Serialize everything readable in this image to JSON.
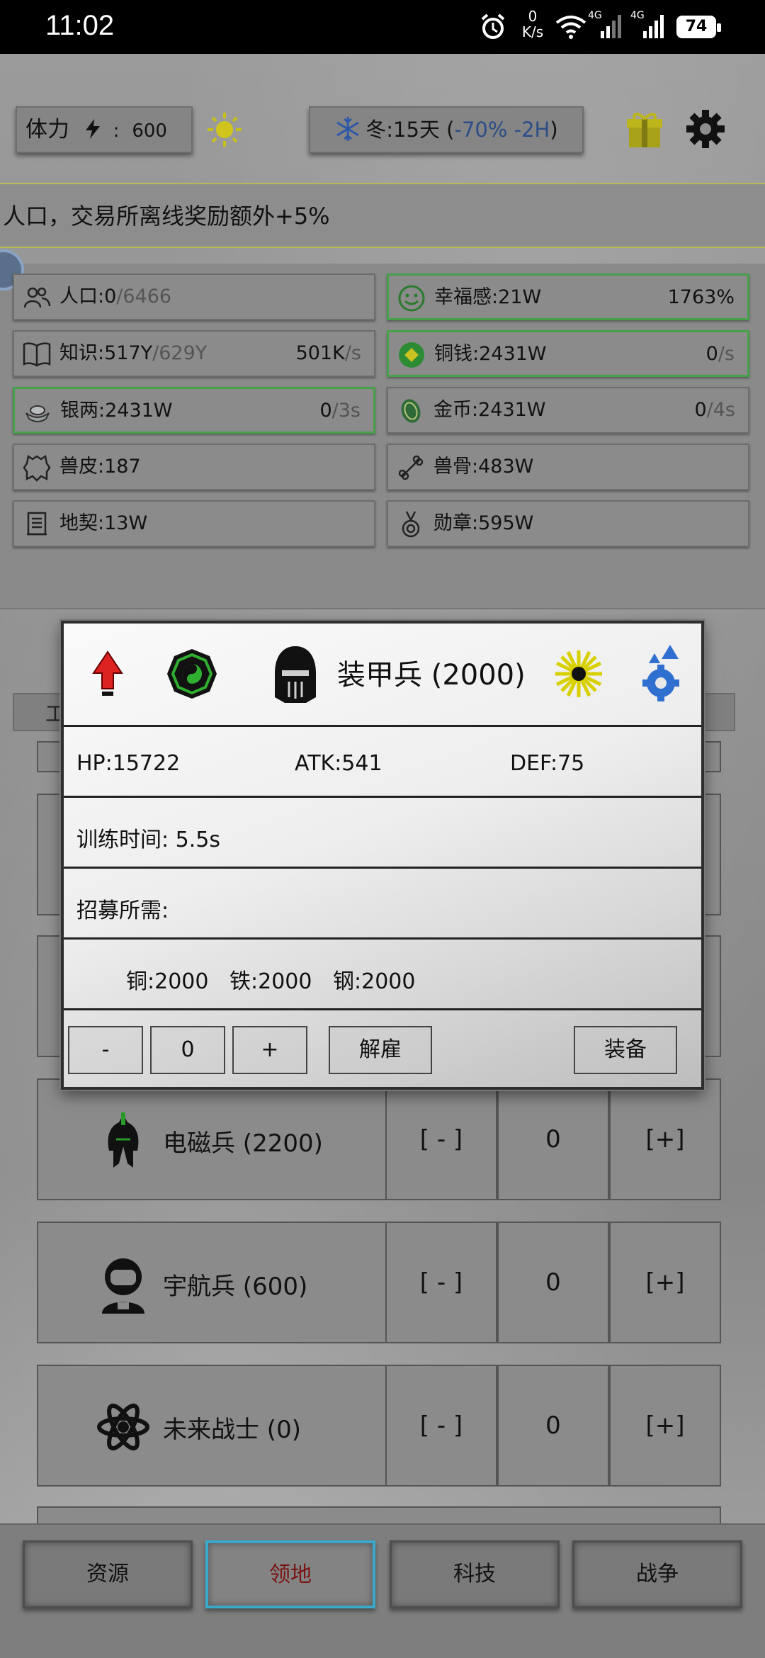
{
  "status_bar": {
    "time": "11:02",
    "net_speed_value": "0",
    "net_speed_unit": "K/s",
    "net_type_1": "4G",
    "net_type_2": "4G",
    "battery": "74",
    "icons": [
      "alarm-icon",
      "wifi-icon",
      "signal-icon",
      "signal-icon",
      "battery-icon"
    ]
  },
  "top_bar": {
    "stamina_label": "体力",
    "stamina_sep": ":",
    "stamina_value": "600",
    "season_text": "冬:15天 (",
    "season_delta": "-70% -2H",
    "season_close": ")",
    "icons": [
      "lightning-icon",
      "sun-icon",
      "snowflake-icon",
      "gift-icon",
      "gear-icon"
    ]
  },
  "ticker": {
    "text": "人口，交易所离线奖励额外+5%"
  },
  "resources": {
    "population": {
      "label": "人口:0",
      "max": "/6466"
    },
    "happiness": {
      "label": "幸福感:21W",
      "rate": "1763%"
    },
    "knowledge": {
      "label": "知识:517Y",
      "max": "/629Y",
      "rate": "501K",
      "rate_unit": "/s"
    },
    "copper_coin": {
      "label": "铜钱:2431W",
      "rate": "0",
      "rate_unit": "/s"
    },
    "silver": {
      "label": "银两:2431W",
      "rate": "0",
      "rate_unit": "/3s"
    },
    "gold": {
      "label": "金币:2431W",
      "rate": "0",
      "rate_unit": "/4s"
    },
    "hide": {
      "label": "兽皮:187"
    },
    "bone": {
      "label": "兽骨:483W"
    },
    "deed": {
      "label": "地契:13W"
    },
    "medal": {
      "label": "勋章:595W"
    }
  },
  "list_header": {
    "label": "工"
  },
  "units": [
    {
      "name": "电磁兵 (2200)",
      "minus": "[ - ]",
      "count": "0",
      "plus": "[+]",
      "icon": "spartan-helmet-icon"
    },
    {
      "name": "宇航兵 (600)",
      "minus": "[ - ]",
      "count": "0",
      "plus": "[+]",
      "icon": "astronaut-icon"
    },
    {
      "name": "未来战士 (0)",
      "minus": "[ - ]",
      "count": "0",
      "plus": "[+]",
      "icon": "atom-icon"
    }
  ],
  "dialog": {
    "title": "装甲兵 (2000)",
    "hp": "HP:15722",
    "atk": "ATK:541",
    "def": "DEF:75",
    "train_time": "训练时间:  5.5s",
    "recruit_label": "招募所需:",
    "cost_copper": "铜:2000",
    "cost_iron": "铁:2000",
    "cost_steel": "钢:2000",
    "minus": "-",
    "quantity": "0",
    "plus": "+",
    "dismiss": "解雇",
    "equip": "装备",
    "icons": [
      "red-up-arrow-icon",
      "green-bagua-icon",
      "knight-helmet-icon",
      "yellow-burst-icon",
      "blue-gear-upgrade-icon"
    ]
  },
  "bottom_nav": [
    {
      "label": "资源",
      "active": false
    },
    {
      "label": "领地",
      "active": true
    },
    {
      "label": "科技",
      "active": false
    },
    {
      "label": "战争",
      "active": false
    }
  ],
  "colors": {
    "active_tab_border": "#3aa9c9",
    "active_tab_text": "#7a1212",
    "green_border": "#47a04a",
    "season_delta": "#2c4e87"
  }
}
